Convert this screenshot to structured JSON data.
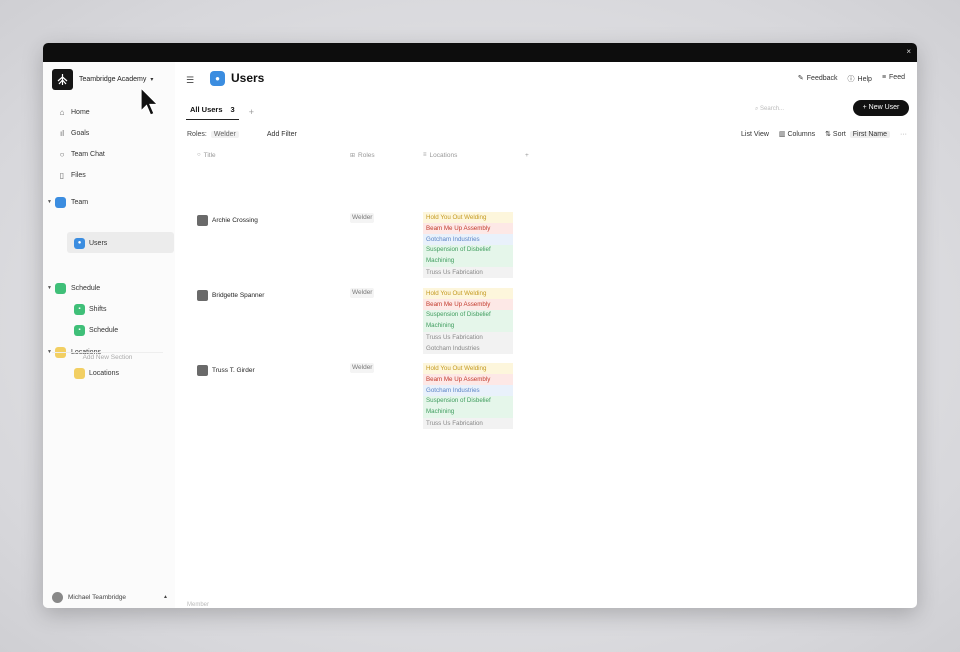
{
  "org": {
    "name": "Teambridge Academy",
    "caret": "▾"
  },
  "sidebar": {
    "nav": [
      {
        "label": "Home",
        "icon": "home-icon"
      },
      {
        "label": "Goals",
        "icon": "chart-icon"
      },
      {
        "label": "Team Chat",
        "icon": "chat-icon"
      },
      {
        "label": "Files",
        "icon": "file-icon"
      }
    ],
    "sections": [
      {
        "label": "Team",
        "color": "#3b8de0",
        "items": [
          {
            "label": "Users"
          }
        ]
      },
      {
        "label": "Schedule",
        "color": "#3fbf78",
        "items": [
          {
            "label": "Shifts"
          },
          {
            "label": "Schedule"
          }
        ]
      },
      {
        "label": "Locations",
        "color": "#f2cf63",
        "items": [
          {
            "label": "Locations"
          }
        ]
      }
    ],
    "add_section": "Add New Section",
    "user": "Michael Teambridge"
  },
  "header": {
    "title": "Users",
    "feedback": "Feedback",
    "help": "Help",
    "feed": "Feed"
  },
  "tabs": {
    "active": "All Users",
    "count": "3",
    "plus": "+"
  },
  "search": {
    "placeholder": "Search..."
  },
  "new_user": "+ New User",
  "filters": {
    "label": "Roles:",
    "value": "Welder",
    "add": "Add Filter"
  },
  "view": {
    "list": "List View",
    "columns": "Columns",
    "sort": "Sort",
    "sort_field": "First Name",
    "more": "···"
  },
  "columns": {
    "title": "Title",
    "roles": "Roles",
    "locations": "Locations",
    "add": "+"
  },
  "users": [
    {
      "name": "Archie Crossing",
      "role": "Welder",
      "locations": [
        {
          "label": "Hold You Out Welding",
          "tone": "yellow"
        },
        {
          "label": "Beam Me Up Assembly",
          "tone": "red"
        },
        {
          "label": "Gotcham Industries",
          "tone": "blue"
        },
        {
          "label": "Suspension of Disbelief Machining",
          "tone": "green"
        },
        {
          "label": "Truss Us Fabrication",
          "tone": "gray"
        }
      ]
    },
    {
      "name": "Bridgette Spanner",
      "role": "Welder",
      "locations": [
        {
          "label": "Hold You Out Welding",
          "tone": "yellow"
        },
        {
          "label": "Beam Me Up Assembly",
          "tone": "red"
        },
        {
          "label": "Suspension of Disbelief Machining",
          "tone": "green"
        },
        {
          "label": "Truss Us Fabrication",
          "tone": "gray"
        },
        {
          "label": "Gotcham Industries",
          "tone": "gray"
        }
      ]
    },
    {
      "name": "Truss T. Girder",
      "role": "Welder",
      "locations": [
        {
          "label": "Hold You Out Welding",
          "tone": "yellow"
        },
        {
          "label": "Beam Me Up Assembly",
          "tone": "red"
        },
        {
          "label": "Gotcham Industries",
          "tone": "blue"
        },
        {
          "label": "Suspension of Disbelief Machining",
          "tone": "green"
        },
        {
          "label": "Truss Us Fabrication",
          "tone": "gray"
        }
      ]
    }
  ],
  "footer_hint": "Member"
}
